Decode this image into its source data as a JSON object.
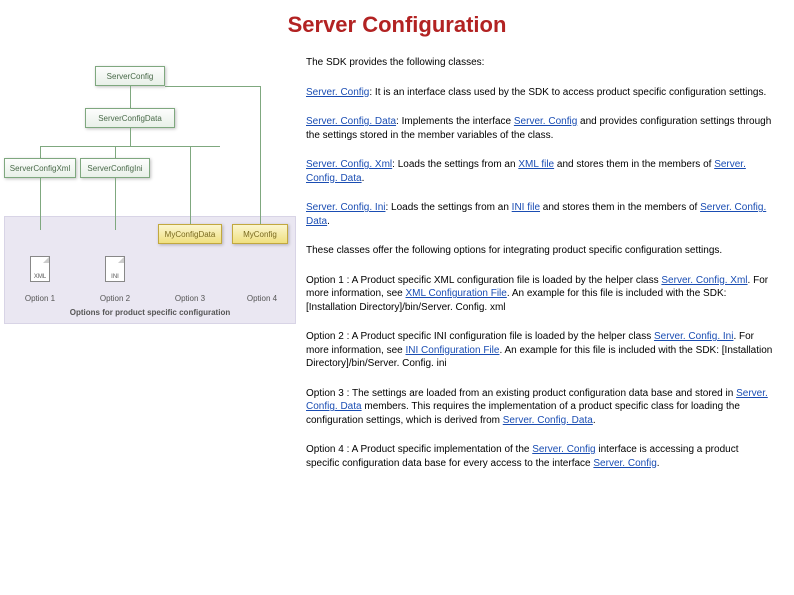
{
  "title": "Server Configuration",
  "intro": "The SDK provides the following classes:",
  "classes": {
    "serverConfig": {
      "name": "Server. Config",
      "desc": ": It is an interface class used by the SDK to access product specific configuration settings."
    },
    "serverConfigData": {
      "name": "Server. Config. Data",
      "desc1": ": Implements the interface ",
      "linkMid": "Server. Config",
      "desc2": " and provides configuration settings through the settings stored in the member variables of the class."
    },
    "serverConfigXml": {
      "name": "Server. Config. Xml",
      "desc1": ": Loads the settings from an ",
      "linkMid": "XML file",
      "desc2": " and stores them in the members of ",
      "linkEnd": "Server. Config. Data"
    },
    "serverConfigIni": {
      "name": "Server. Config. Ini",
      "desc1": ": Loads the settings from an ",
      "linkMid": "INI file",
      "desc2": " and stores them in the members of ",
      "linkEnd": "Server. Config. Data"
    }
  },
  "optionsIntro": "These classes offer the following options for integrating product specific configuration settings.",
  "options": {
    "o1": {
      "pre": "Option 1 : A Product specific XML configuration file is loaded by the helper class ",
      "link1": "Server. Config. Xml",
      "mid": ". For more information, see ",
      "link2": "XML Configuration File",
      "post": ". An example for this file is included with the SDK: [Installation Directory]/bin/Server. Config. xml"
    },
    "o2": {
      "pre": "Option 2 : A Product specific INI configuration file is loaded by the helper class ",
      "link1": "Server. Config. Ini",
      "mid": ". For more information, see ",
      "link2": "INI Configuration File",
      "post": ". An example for this file is included with the SDK: [Installation Directory]/bin/Server. Config. ini"
    },
    "o3": {
      "pre": "Option 3 : The settings are loaded from an existing product configuration data base and stored in ",
      "link1": "Server. Config. Data",
      "mid": " members. This requires the implementation of a product specific class for loading the configuration settings, which is derived from ",
      "link2": "Server. Config. Data",
      "post": "."
    },
    "o4": {
      "pre": "Option 4 : A Product specific implementation of the ",
      "link1": "Server. Config",
      "mid": " interface is accessing a product specific configuration data base for every access to the interface ",
      "link2": "Server. Config",
      "post": "."
    }
  },
  "diagram": {
    "top": "ServerConfig",
    "mid": "ServerConfigData",
    "left": "ServerConfigXml",
    "right": "ServerConfigIni",
    "y1": "MyConfigData",
    "y2": "MyConfig",
    "xml": "XML",
    "ini": "INI",
    "opt1": "Option 1",
    "opt2": "Option 2",
    "opt3": "Option 3",
    "opt4": "Option 4",
    "caption": "Options for product specific configuration"
  }
}
